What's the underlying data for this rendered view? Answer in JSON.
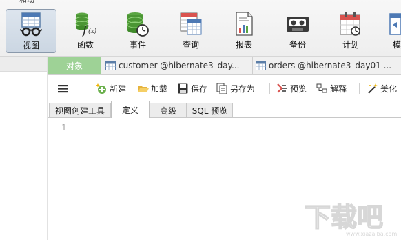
{
  "ribbon": {
    "cut_label": "和动",
    "buttons": [
      {
        "label": "视图",
        "icon": "glasses-view-icon",
        "active": true
      },
      {
        "label": "函数",
        "icon": "function-fx-icon",
        "active": false
      },
      {
        "label": "事件",
        "icon": "database-clock-icon",
        "active": false
      },
      {
        "label": "查询",
        "icon": "query-table-icon",
        "active": false
      },
      {
        "label": "报表",
        "icon": "report-chart-icon",
        "active": false
      },
      {
        "label": "备份",
        "icon": "tape-backup-icon",
        "active": false
      },
      {
        "label": "计划",
        "icon": "calendar-schedule-icon",
        "active": false
      },
      {
        "label": "模",
        "icon": "model-icon",
        "active": false
      }
    ]
  },
  "doc_tabs": {
    "object_label": "对象",
    "tabs": [
      {
        "label": "customer @hibernate3_day...",
        "icon": "table-icon"
      },
      {
        "label": "orders @hibernate3_day01 ...",
        "icon": "table-icon"
      }
    ]
  },
  "toolbar": {
    "menu_icon": "hamburger-menu-icon",
    "items": [
      {
        "label": "新建",
        "icon": "new-add-icon"
      },
      {
        "label": "加载",
        "icon": "folder-open-icon"
      },
      {
        "label": "保存",
        "icon": "save-disk-icon"
      },
      {
        "label": "另存为",
        "icon": "save-as-icon"
      },
      {
        "label": "预览",
        "icon": "preview-icon"
      },
      {
        "label": "解释",
        "icon": "explain-icon"
      },
      {
        "label": "美化",
        "icon": "beautify-wand-icon"
      }
    ]
  },
  "editor_tabs": [
    {
      "label": "视图创建工具",
      "active": false
    },
    {
      "label": "定义",
      "active": true
    },
    {
      "label": "高级",
      "active": false
    },
    {
      "label": "SQL 预览",
      "active": false
    }
  ],
  "editor": {
    "line_numbers": [
      "1"
    ]
  },
  "watermark": {
    "text": "下载吧",
    "url_text": "www.xiazaiba.com"
  },
  "colors": {
    "object_tab": "#9ed296",
    "active_ribbon": "#cbd6e2"
  }
}
